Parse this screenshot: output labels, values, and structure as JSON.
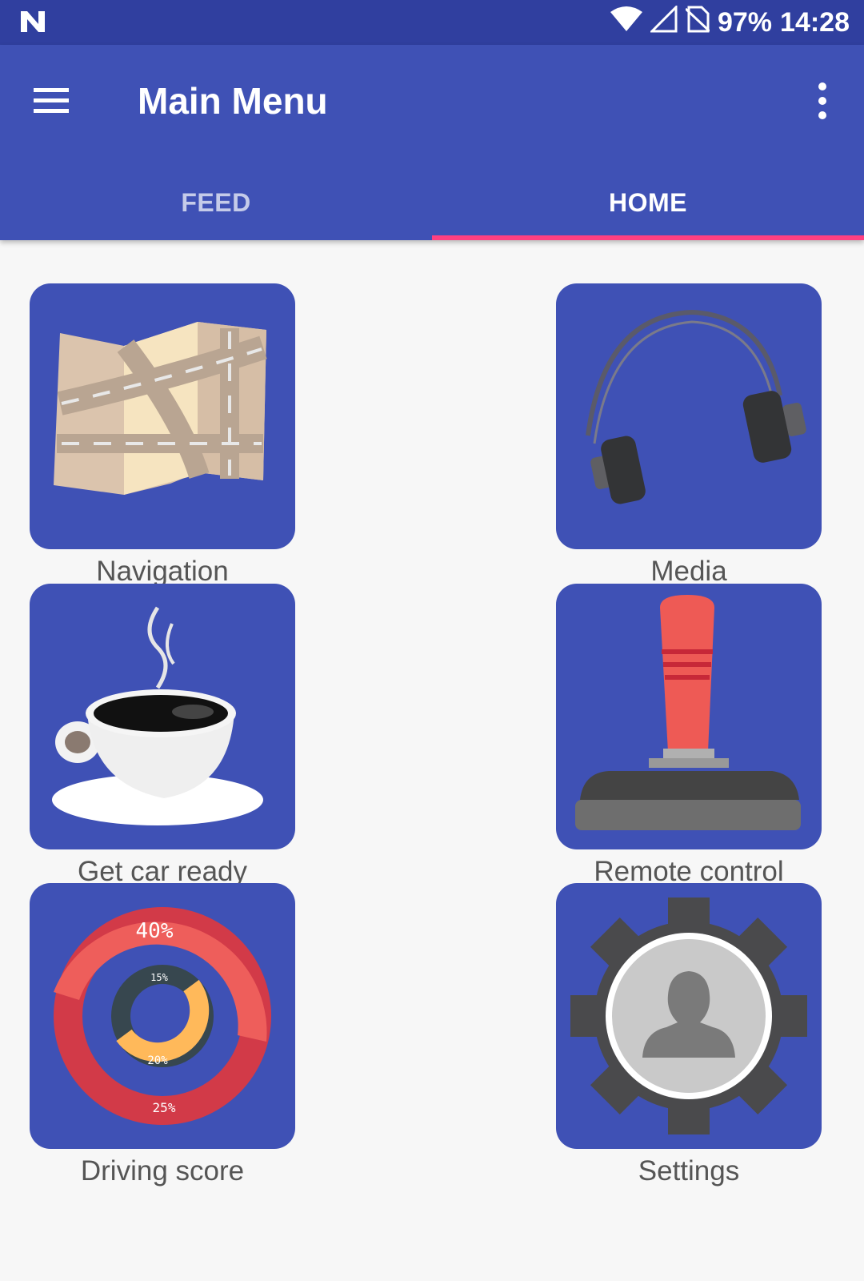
{
  "status_bar": {
    "battery": "97%",
    "time": "14:28",
    "icons": [
      "notification-n-icon",
      "wifi-icon",
      "cell-signal-icon",
      "no-sim-icon"
    ]
  },
  "app_bar": {
    "title": "Main Menu",
    "menu_icon": "hamburger-menu-icon",
    "overflow_icon": "more-vert-icon"
  },
  "tabs": [
    {
      "label": "FEED",
      "active": false
    },
    {
      "label": "HOME",
      "active": true
    }
  ],
  "tiles": [
    {
      "label": "Navigation",
      "icon": "folded-map-icon"
    },
    {
      "label": "Media",
      "icon": "headphones-icon"
    },
    {
      "label": "Get car ready",
      "icon": "coffee-cup-icon"
    },
    {
      "label": "Remote control",
      "icon": "joystick-icon"
    },
    {
      "label": "Driving score",
      "icon": "donut-chart-icon",
      "chart_labels": [
        "40%",
        "15%",
        "20%",
        "25%"
      ]
    },
    {
      "label": "Settings",
      "icon": "gear-profile-icon"
    }
  ],
  "colors": {
    "primary": "#3f51b5",
    "primary_dark": "#303f9f",
    "accent": "#ff4081",
    "background": "#f7f7f7",
    "label_text": "#555555"
  }
}
